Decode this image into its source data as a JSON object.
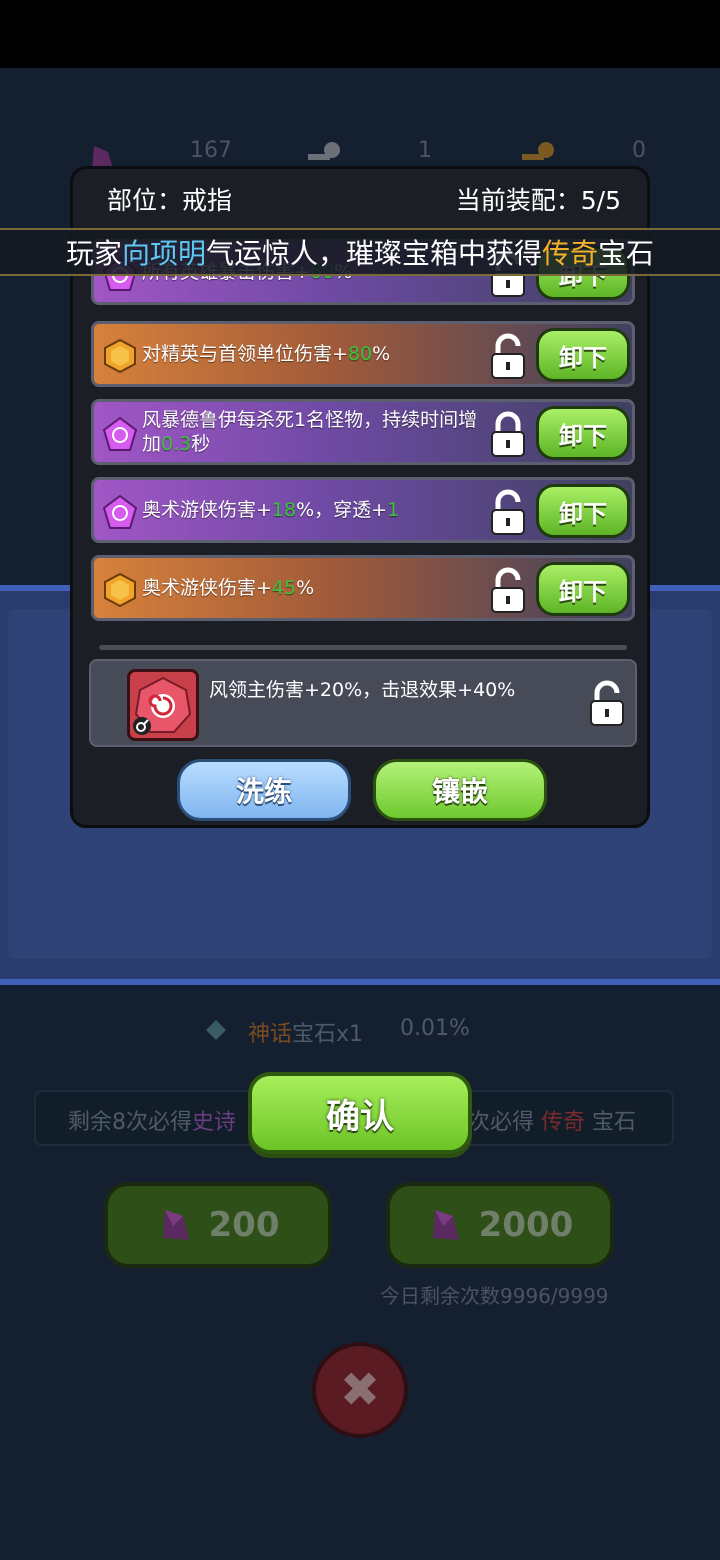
{
  "background": {
    "currency": [
      {
        "icon": "purple-gem-icon",
        "value": "167"
      },
      {
        "icon": "silver-key-icon",
        "value": "1"
      },
      {
        "icon": "gold-key-icon",
        "value": "0"
      }
    ],
    "drop_rate_row": {
      "rarity": "神话",
      "suffix": "宝石x1",
      "rate": "0.01%"
    },
    "pity": {
      "left_prefix": "剩余8次必得",
      "left_rarity": "史诗",
      "right_suffix_prefix": "次必得",
      "right_rarity": "传奇",
      "right_suffix": "宝石"
    },
    "confirm_label": "确认",
    "buy_buttons": [
      {
        "value": "200"
      },
      {
        "value": "2000"
      }
    ],
    "daily_remaining": "今日剩余次数9996/9999",
    "close_icon": "close-icon"
  },
  "modal": {
    "slot_label": "部位：戒指",
    "equip_label": "当前装配：5/5",
    "gems": [
      {
        "type": "purple",
        "text_parts": [
          "所有英雄暴击伤害+",
          "60",
          "%"
        ],
        "locked": false,
        "button": "卸下"
      },
      {
        "type": "orange",
        "text_parts": [
          "对精英与首领单位伤害+",
          "80",
          "%"
        ],
        "locked": false,
        "button": "卸下"
      },
      {
        "type": "purple",
        "text_parts": [
          "风暴德鲁伊每杀死1名怪物，持续时间增加",
          "0.3",
          "秒"
        ],
        "locked": true,
        "button": "卸下"
      },
      {
        "type": "purple",
        "text_parts": [
          "奥术游侠伤害+",
          "18",
          "%，穿透+",
          "1",
          ""
        ],
        "locked": false,
        "button": "卸下"
      },
      {
        "type": "orange",
        "text_parts": [
          "奥术游侠伤害+",
          "45",
          "%"
        ],
        "locked": false,
        "button": "卸下"
      }
    ],
    "new_gem": {
      "text": "风领主伤害+20%，击退效果+40%",
      "icon": "red-spiral-gem-icon",
      "locked": false
    },
    "wash_label": "洗练",
    "inlay_label": "镶嵌"
  },
  "broadcast": {
    "prefix": "玩家",
    "player": "向项明",
    "middle": "气运惊人，璀璨宝箱中获得",
    "rarity": "传奇",
    "suffix": "宝石"
  },
  "colors": {
    "highlight_green": "#3bc43b",
    "legendary_orange": "#f5b02c",
    "player_blue": "#5ec8f5"
  }
}
